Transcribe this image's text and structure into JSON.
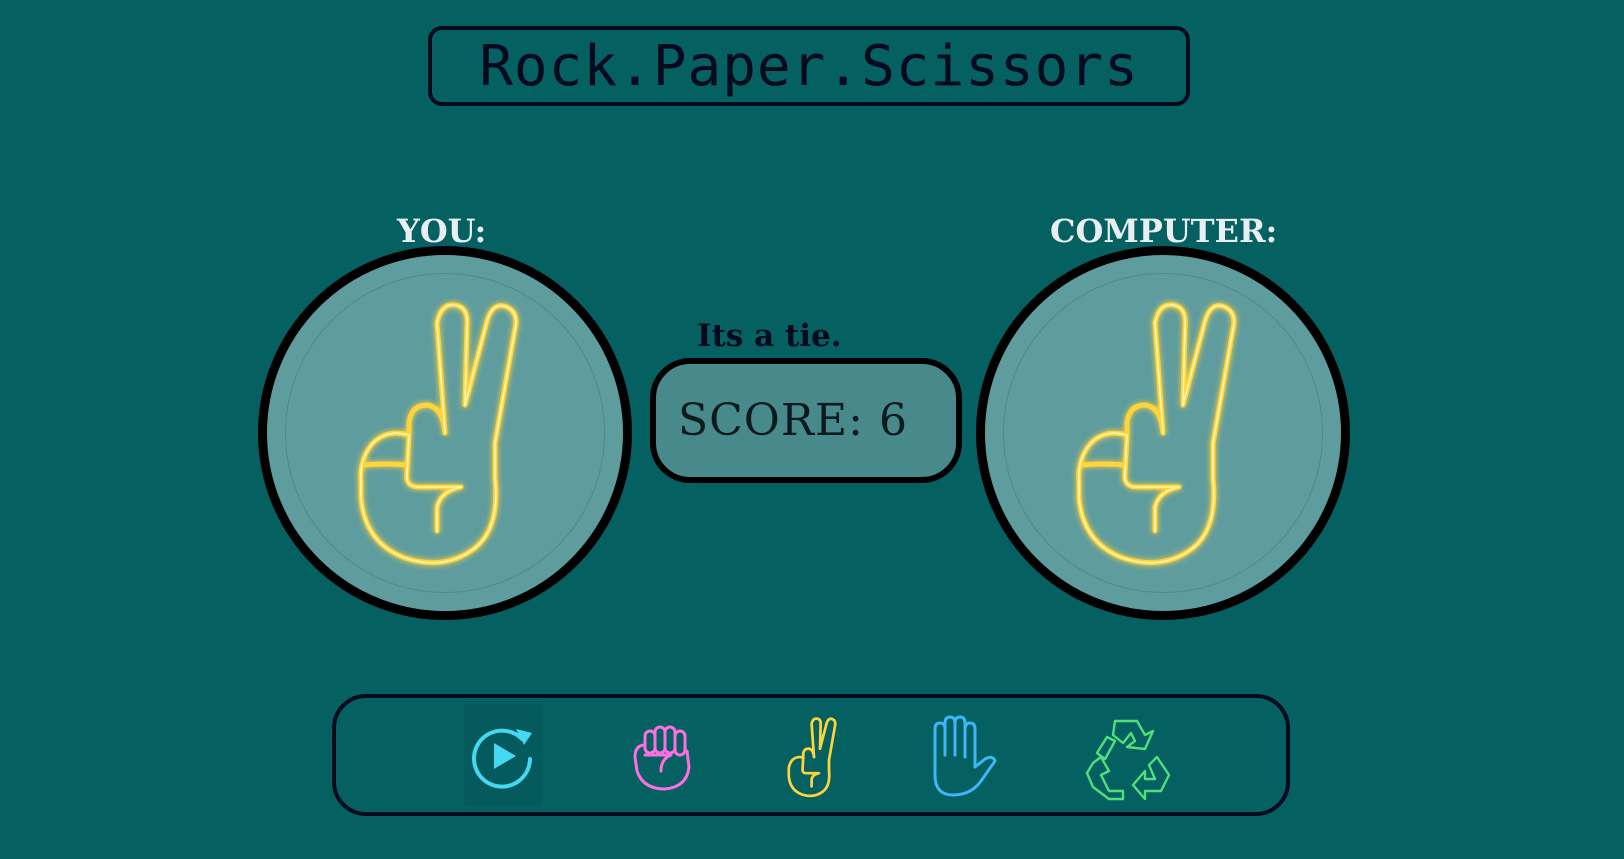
{
  "title": "Rock.Paper.Scissors",
  "players": {
    "you_label": "YOU:",
    "computer_label": "COMPUTER:",
    "you_choice_icon": "scissors-hand-icon",
    "computer_choice_icon": "scissors-hand-icon"
  },
  "result": "Its a tie.",
  "score": "SCORE: 6",
  "toolbar": {
    "items": [
      {
        "name": "play-restart",
        "icon": "play-restart-icon",
        "color": "#46d8f2"
      },
      {
        "name": "rock",
        "icon": "rock-fist-icon",
        "color": "#ff6fe0"
      },
      {
        "name": "scissors",
        "icon": "scissors-hand-icon",
        "color": "#ffd43a"
      },
      {
        "name": "paper",
        "icon": "paper-hand-icon",
        "color": "#3fb6f5"
      },
      {
        "name": "reset",
        "icon": "recycle-icon",
        "color": "#4fe07a"
      }
    ]
  },
  "colors": {
    "background": "#056062",
    "circle_fill": "#5f9c9e",
    "neon_yellow": "#ffd43a",
    "dark_ink": "#050a1e"
  }
}
